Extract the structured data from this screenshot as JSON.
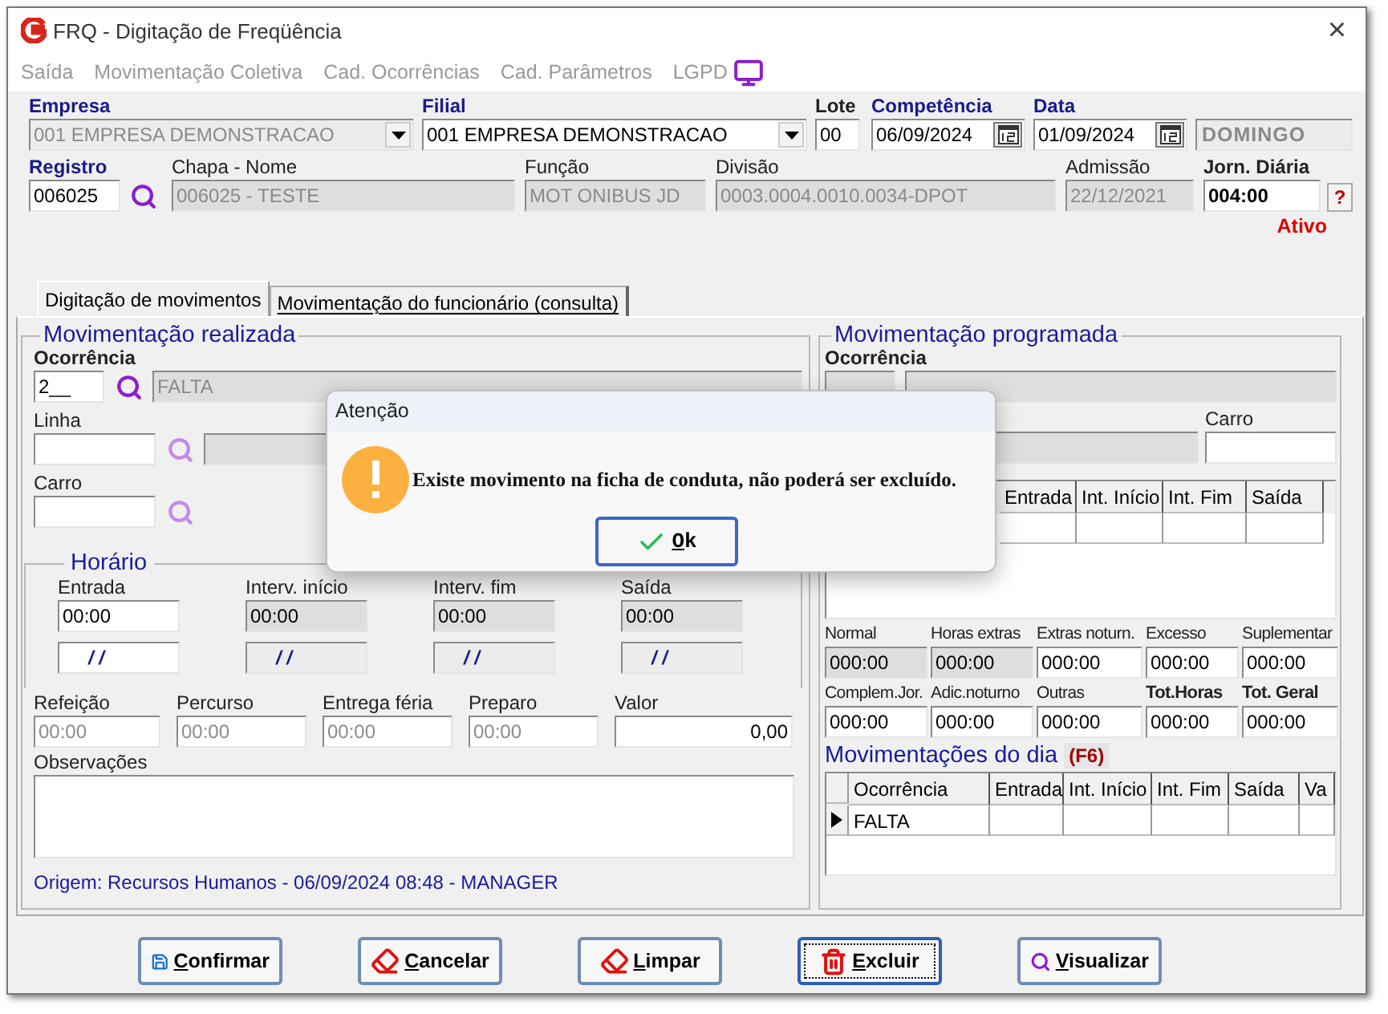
{
  "window": {
    "title": "FRQ - Digitação de Freqüência",
    "close": "×"
  },
  "menu": [
    "Saída",
    "Movimentação Coletiva",
    "Cad. Ocorrências",
    "Cad. Parâmetros",
    "LGPD"
  ],
  "header": {
    "empresa": {
      "label": "Empresa",
      "value": "001 EMPRESA DEMONSTRACAO",
      "disabled": true
    },
    "filial": {
      "label": "Filial",
      "value": "001 EMPRESA DEMONSTRACAO",
      "disabled": false
    },
    "lote": {
      "label": "Lote",
      "value": "00"
    },
    "competencia": {
      "label": "Competência",
      "value": "06/09/2024"
    },
    "data": {
      "label": "Data",
      "value": "01/09/2024"
    },
    "weekday": "DOMINGO",
    "registro": {
      "label": "Registro",
      "value": "006025"
    },
    "chapa_nome": {
      "label": "Chapa  -  Nome",
      "value": "006025 - TESTE"
    },
    "funcao": {
      "label": "Função",
      "value": "MOT ONIBUS JD"
    },
    "divisao": {
      "label": "Divisão",
      "value": "0003.0004.0010.0034-DPOT"
    },
    "admissao": {
      "label": "Admissão",
      "value": "22/12/2021"
    },
    "jornada": {
      "label": "Jorn. Diária",
      "value": "004:00"
    },
    "help": "?",
    "status": "Ativo"
  },
  "tabs": [
    {
      "label": "Digitação de movimentos",
      "selected": true
    },
    {
      "label": "Movimentação do funcionário (consulta)",
      "selected": false
    }
  ],
  "realizada": {
    "title": "Movimentação realizada",
    "ocorrencia": {
      "label": "Ocorrência",
      "code": "2__",
      "description": "FALTA"
    },
    "linha": {
      "label": "Linha"
    },
    "carro": {
      "label": "Carro"
    },
    "horario": {
      "title": "Horário",
      "columns": [
        {
          "label": "Entrada",
          "time": "00:00",
          "date": "/ /",
          "disabled": false
        },
        {
          "label": "Interv. início",
          "time": "00:00",
          "date": "/ /",
          "disabled": true
        },
        {
          "label": "Interv. fim",
          "time": "00:00",
          "date": "/ /",
          "disabled": true
        },
        {
          "label": "Saída",
          "time": "00:00",
          "date": "/ /",
          "disabled": true
        }
      ]
    },
    "extras": [
      {
        "label": "Refeição",
        "value": "00:00",
        "disabled": true
      },
      {
        "label": "Percurso",
        "value": "00:00",
        "disabled": true
      },
      {
        "label": "Entrega féria",
        "value": "00:00",
        "disabled": true
      },
      {
        "label": "Preparo",
        "value": "00:00",
        "disabled": true
      },
      {
        "label": "Valor",
        "value": "0,00",
        "disabled": false
      }
    ],
    "observacoes": {
      "label": "Observações"
    },
    "origem": "Origem: Recursos Humanos - 06/09/2024 08:48 - MANAGER"
  },
  "programada": {
    "title": "Movimentação programada",
    "ocorrencia_label": "Ocorrência",
    "carro_label": "Carro",
    "columns": [
      "Entrada",
      "Int. Início",
      "Int. Fim",
      "Saída"
    ],
    "totals": [
      {
        "label": "Normal",
        "value": "000:00",
        "disabled": true,
        "bold": false
      },
      {
        "label": "Horas extras",
        "value": "000:00",
        "disabled": true,
        "bold": false
      },
      {
        "label": "Extras noturn.",
        "value": "000:00",
        "disabled": false,
        "bold": false
      },
      {
        "label": "Excesso",
        "value": "000:00",
        "disabled": false,
        "bold": false
      },
      {
        "label": "Suplementar",
        "value": "000:00",
        "disabled": false,
        "bold": false
      },
      {
        "label": "Complem.Jor.",
        "value": "000:00",
        "disabled": false,
        "bold": false
      },
      {
        "label": "Adic.noturno",
        "value": "000:00",
        "disabled": false,
        "bold": false
      },
      {
        "label": "Outras",
        "value": "000:00",
        "disabled": false,
        "bold": false
      },
      {
        "label": "Tot.Horas",
        "value": "000:00",
        "disabled": false,
        "bold": true
      },
      {
        "label": "Tot. Geral",
        "value": "000:00",
        "disabled": false,
        "bold": true
      }
    ]
  },
  "dia": {
    "title": "Movimentações do dia",
    "shortcut": "(F6)",
    "columns": [
      "Ocorrência",
      "Entrada",
      "Int. Início",
      "Int. Fim",
      "Saída",
      "Va"
    ],
    "rows": [
      {
        "ocorrencia": "FALTA",
        "selected": true
      }
    ]
  },
  "buttons": [
    {
      "label": "Confirmar",
      "kind": "save",
      "focused": false
    },
    {
      "label": "Cancelar",
      "kind": "erase",
      "focused": false
    },
    {
      "label": "Limpar",
      "kind": "erase",
      "focused": false
    },
    {
      "label": "Excluir",
      "kind": "delete",
      "focused": true
    },
    {
      "label": "Visualizar",
      "kind": "view",
      "focused": false
    }
  ],
  "dialog": {
    "title": "Atenção",
    "message": "Existe movimento na ficha de conduta, não poderá ser excluído.",
    "ok": "Ok"
  }
}
